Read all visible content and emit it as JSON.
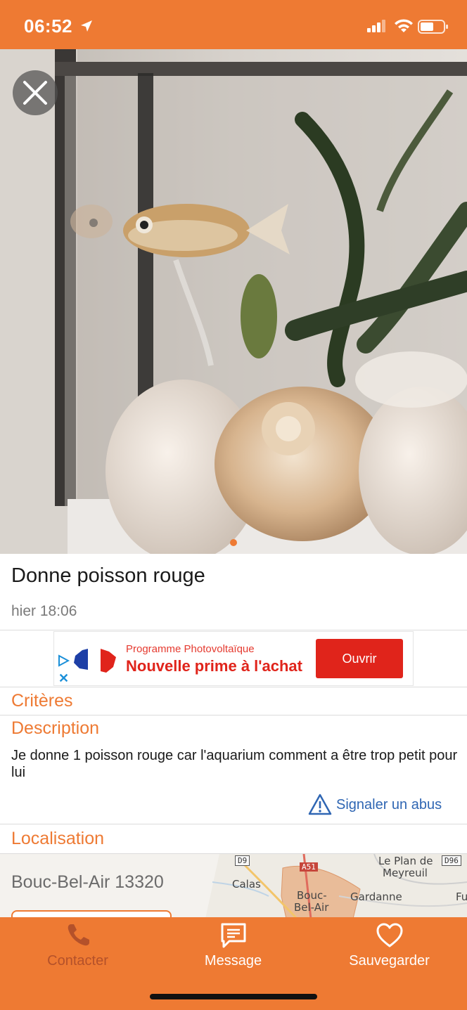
{
  "status_bar": {
    "time": "06:52",
    "icons": [
      "location-arrow-icon",
      "signal-icon",
      "wifi-icon",
      "battery-icon"
    ]
  },
  "gallery": {
    "image": "goldfish-aquarium-photo",
    "close_icon": "close-icon",
    "page_count": 1,
    "current_page": 1
  },
  "listing": {
    "title": "Donne poisson rouge",
    "posted": "hier 18:06"
  },
  "ad": {
    "small_text": "Programme Photovoltaïque",
    "headline": "Nouvelle prime à l'achat",
    "button_label": "Ouvrir"
  },
  "sections": {
    "criteria_heading": "Critères",
    "description_heading": "Description",
    "description_text": "Je donne 1 poisson rouge car l'aquarium comment a être trop petit pour lui",
    "report_label": "Signaler un abus",
    "location_heading": "Localisation",
    "location_city": "Bouc-Bel-Air 13320"
  },
  "map": {
    "labels": [
      "Le Plan de",
      "Meyreuil",
      "Calas",
      "Bouc-",
      "Bel-Air",
      "Gardanne",
      "Fu"
    ],
    "roads": [
      "D9",
      "A51",
      "D96"
    ]
  },
  "tabbar": {
    "items": [
      {
        "label": "Contacter",
        "icon": "phone-icon",
        "enabled": false
      },
      {
        "label": "Message",
        "icon": "message-icon",
        "enabled": true
      },
      {
        "label": "Sauvegarder",
        "icon": "heart-icon",
        "enabled": true
      }
    ]
  },
  "colors": {
    "accent": "#ee7a33",
    "link": "#2f66b3",
    "ad_red": "#e0241b"
  }
}
